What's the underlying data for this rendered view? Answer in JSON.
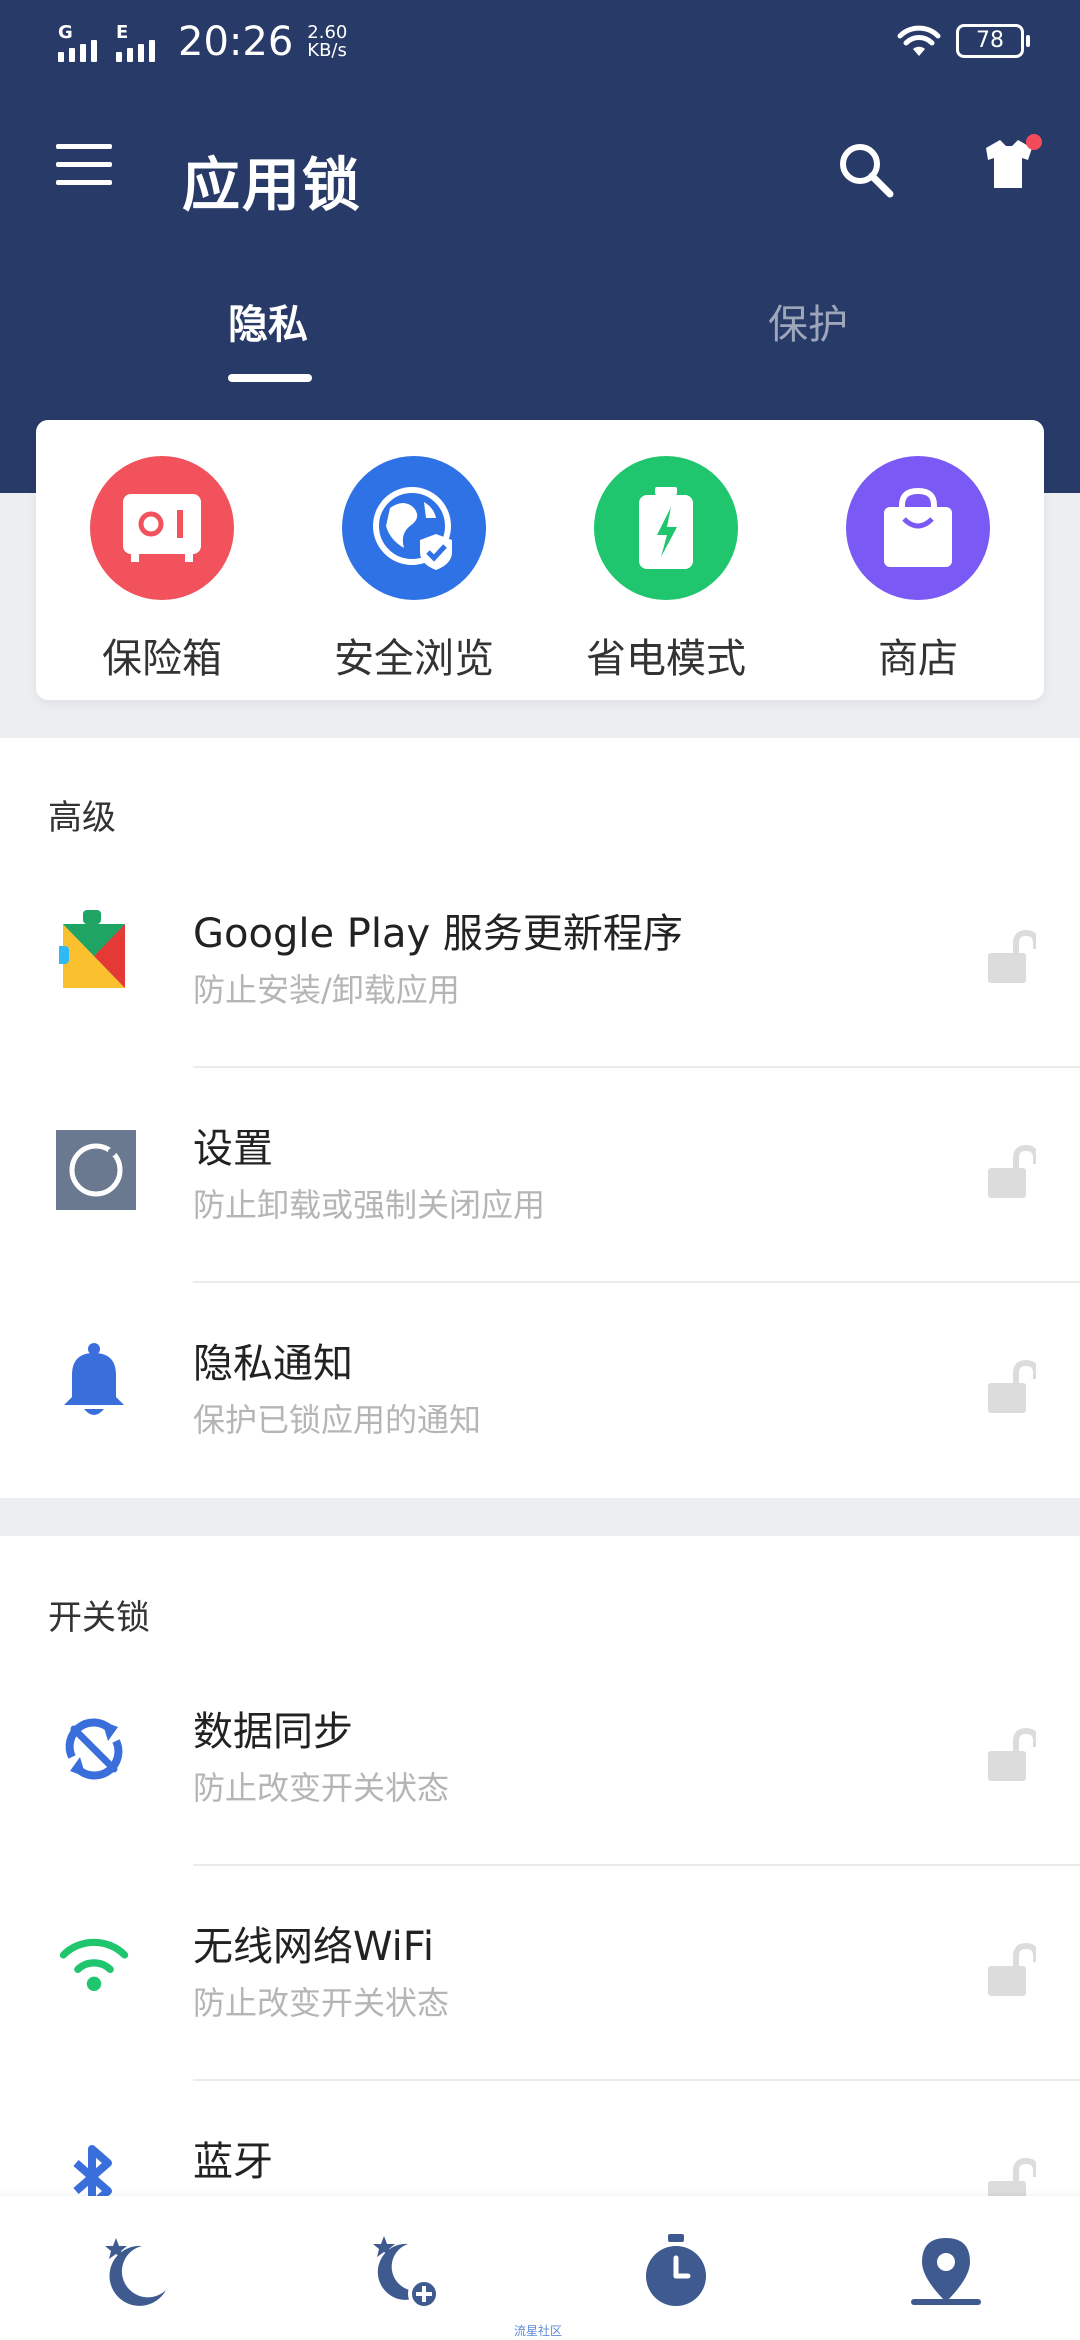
{
  "status": {
    "network1": "G",
    "network2": "E",
    "time": "20:26",
    "speed_value": "2.60",
    "speed_unit": "KB/s",
    "battery": "78"
  },
  "appbar": {
    "title": "应用锁"
  },
  "tabs": [
    {
      "label": "隐私",
      "active": true
    },
    {
      "label": "保护",
      "active": false
    }
  ],
  "shortcuts": [
    {
      "label": "保险箱",
      "color": "#f1525b",
      "icon": "safe-icon"
    },
    {
      "label": "安全浏览",
      "color": "#2f72e6",
      "icon": "secure-browser-icon"
    },
    {
      "label": "省电模式",
      "color": "#1fc66e",
      "icon": "battery-saver-icon"
    },
    {
      "label": "商店",
      "color": "#7b59f4",
      "icon": "shopping-bag-icon"
    }
  ],
  "advanced": {
    "title": "高级",
    "items": [
      {
        "title": "Google Play 服务更新程序",
        "subtitle": "防止安装/卸载应用",
        "icon": "google-play-icon"
      },
      {
        "title": "设置",
        "subtitle": "防止卸载或强制关闭应用",
        "icon": "settings-icon"
      },
      {
        "title": "隐私通知",
        "subtitle": "保护已锁应用的通知",
        "icon": "bell-icon"
      }
    ]
  },
  "switch_lock": {
    "title": "开关锁",
    "items": [
      {
        "title": "数据同步",
        "subtitle": "防止改变开关状态",
        "icon": "sync-icon"
      },
      {
        "title": "无线网络WiFi",
        "subtitle": "防止改变开关状态",
        "icon": "wifi-icon"
      },
      {
        "title": "蓝牙",
        "subtitle": "",
        "icon": "bluetooth-icon"
      }
    ]
  },
  "bottom_nav": [
    {
      "icon": "moon-star-icon"
    },
    {
      "icon": "moon-add-icon"
    },
    {
      "icon": "timer-icon"
    },
    {
      "icon": "location-icon"
    }
  ],
  "watermark": "流星社区",
  "colors": {
    "header": "#283a67",
    "accent_blue": "#3a6fdb",
    "lock_gray": "#dcdcdc"
  }
}
